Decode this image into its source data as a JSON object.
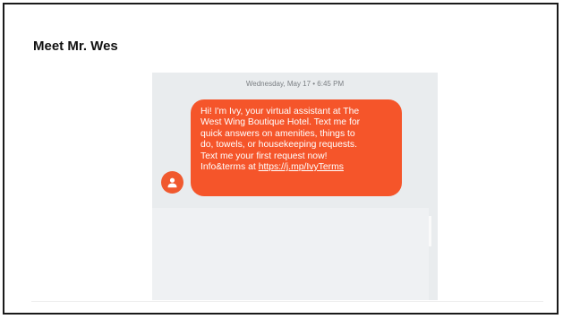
{
  "slide": {
    "title": "Meet Mr. Wes"
  },
  "conversation": {
    "timestamp": "Wednesday, May 17 • 6:45 PM",
    "message": {
      "text": "Hi! I'm Ivy, your virtual assistant at The\nWest Wing Boutique Hotel. Text me for\nquick answers on amenities, things to\ndo, towels, or housekeeping requests.\nText me your first request now!\nInfo&terms at ",
      "link_text": "https://j.mp/IvyTerms"
    }
  },
  "icons": {
    "avatar": "person-icon"
  },
  "colors": {
    "bubble": "#f5552a",
    "avatar": "#f0592e",
    "screen_background": "#e9ecee",
    "slide_border": "#1a1a1a"
  }
}
